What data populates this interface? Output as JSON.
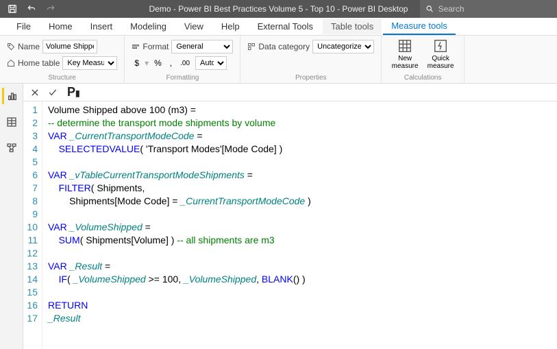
{
  "titlebar": {
    "title": "Demo - Power BI Best Practices Volume 5 - Top 10 - Power BI Desktop",
    "search_placeholder": "Search"
  },
  "ribbon_tabs": {
    "file": "File",
    "home": "Home",
    "insert": "Insert",
    "modeling": "Modeling",
    "view": "View",
    "help": "Help",
    "external": "External Tools",
    "table_tools": "Table tools",
    "measure_tools": "Measure tools"
  },
  "structure": {
    "group_label": "Structure",
    "name_label": "Name",
    "name_value": "Volume Shipped a...",
    "home_table_label": "Home table",
    "home_table_value": "Key Measures"
  },
  "formatting": {
    "group_label": "Formatting",
    "format_label": "Format",
    "format_value": "General",
    "dollar": "$",
    "percent": "%",
    "comma": ",",
    "decimals_value": "Auto"
  },
  "properties": {
    "group_label": "Properties",
    "data_category_label": "Data category",
    "data_category_value": "Uncategorized"
  },
  "calculations": {
    "group_label": "Calculations",
    "new_measure": "New measure",
    "quick_measure": "Quick measure"
  },
  "code": {
    "lines": [
      [
        [
          "",
          "Volume Shipped above 100 (m3) ="
        ]
      ],
      [
        [
          "cm",
          "-- determine the transport mode shipments by volume"
        ]
      ],
      [
        [
          "kw",
          "VAR"
        ],
        [
          "",
          " "
        ],
        [
          "var",
          "_CurrentTransportModeCode"
        ],
        [
          "",
          " ="
        ]
      ],
      [
        [
          "",
          "    "
        ],
        [
          "fn",
          "SELECTEDVALUE"
        ],
        [
          "",
          "( 'Transport Modes'[Mode Code] )"
        ]
      ],
      [
        [
          "",
          ""
        ]
      ],
      [
        [
          "kw",
          "VAR"
        ],
        [
          "",
          " "
        ],
        [
          "var",
          "_vTableCurrentTransportModeShipments"
        ],
        [
          "",
          " ="
        ]
      ],
      [
        [
          "",
          "    "
        ],
        [
          "fn",
          "FILTER"
        ],
        [
          "",
          "( Shipments,"
        ]
      ],
      [
        [
          "",
          "        Shipments[Mode Code] = "
        ],
        [
          "var",
          "_CurrentTransportModeCode"
        ],
        [
          "",
          " )"
        ]
      ],
      [
        [
          "",
          ""
        ]
      ],
      [
        [
          "kw",
          "VAR"
        ],
        [
          "",
          " "
        ],
        [
          "var",
          "_VolumeShipped"
        ],
        [
          "",
          " ="
        ]
      ],
      [
        [
          "",
          "    "
        ],
        [
          "fn",
          "SUM"
        ],
        [
          "",
          "( Shipments[Volume] ) "
        ],
        [
          "cm",
          "-- all shipments are m3"
        ]
      ],
      [
        [
          "",
          ""
        ]
      ],
      [
        [
          "kw",
          "VAR"
        ],
        [
          "",
          " "
        ],
        [
          "var",
          "_Result"
        ],
        [
          "",
          " ="
        ]
      ],
      [
        [
          "",
          "    "
        ],
        [
          "fn",
          "IF"
        ],
        [
          "",
          "( "
        ],
        [
          "var",
          "_VolumeShipped"
        ],
        [
          "",
          " >= 100, "
        ],
        [
          "var",
          "_VolumeShipped"
        ],
        [
          "",
          ", "
        ],
        [
          "fn",
          "BLANK"
        ],
        [
          "",
          "() )"
        ]
      ],
      [
        [
          "",
          ""
        ]
      ],
      [
        [
          "kw",
          "RETURN"
        ]
      ],
      [
        [
          "var",
          "_Result"
        ]
      ]
    ]
  }
}
